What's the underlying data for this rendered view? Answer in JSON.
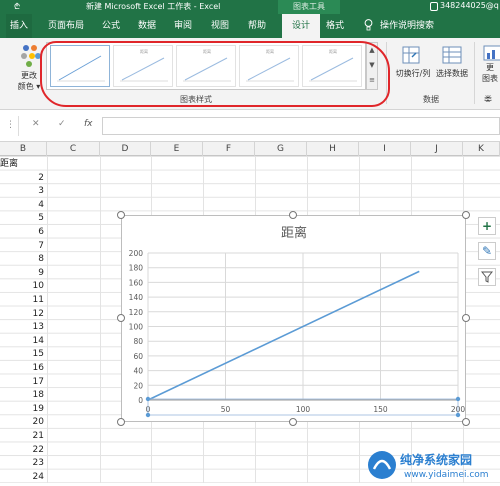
{
  "titlebar": {
    "qa": "₾",
    "document_title": "新建 Microsoft Excel 工作表  -  Excel",
    "context_tab_group": "图表工具",
    "user": "348244025@q"
  },
  "ribbon_tabs": [
    {
      "label": "插入"
    },
    {
      "label": "页面布局"
    },
    {
      "label": "公式"
    },
    {
      "label": "数据"
    },
    {
      "label": "审阅"
    },
    {
      "label": "视图"
    },
    {
      "label": "帮助"
    },
    {
      "label": "设计"
    },
    {
      "label": "格式"
    },
    {
      "label": "操作说明搜索"
    }
  ],
  "ribbon": {
    "change_colors": {
      "line1": "更改",
      "line2": "颜色 ▾"
    },
    "chart_styles_group": "图表样式",
    "switch_row_col": "切换行/列",
    "select_data": "选择数据",
    "data_group": "数据",
    "change_type": {
      "line1": "更",
      "line2": "图表",
      "line3": "类"
    }
  },
  "formula_bar": {
    "cancel": "✕",
    "confirm": "✓",
    "fx": "fx",
    "value": ""
  },
  "columns": [
    "B",
    "C",
    "D",
    "E",
    "F",
    "G",
    "H",
    "I",
    "J",
    "K"
  ],
  "column_b_values": [
    "距离",
    "2",
    "3",
    "4",
    "5",
    "6",
    "7",
    "8",
    "9",
    "10",
    "11",
    "12",
    "13",
    "14",
    "15",
    "16",
    "17",
    "18",
    "19",
    "20",
    "21",
    "22",
    "23",
    "24"
  ],
  "chart_data": {
    "type": "scatter",
    "title": "距离",
    "series": [
      {
        "x": [
          0,
          175
        ],
        "y": [
          0,
          175
        ]
      }
    ],
    "xlim": [
      0,
      200
    ],
    "ylim": [
      0,
      200
    ],
    "x_ticks": [
      "0",
      "50",
      "100",
      "150",
      "200"
    ],
    "y_ticks": [
      "0",
      "20",
      "40",
      "60",
      "80",
      "100",
      "120",
      "140",
      "160",
      "180",
      "200"
    ],
    "grid": true,
    "line_color": "#5b9bd5"
  },
  "side_buttons": {
    "add": "+",
    "style": "✎",
    "filter": "⊿"
  },
  "colors": {
    "excel_green": "#217346",
    "annotation_red": "#e0262a"
  }
}
